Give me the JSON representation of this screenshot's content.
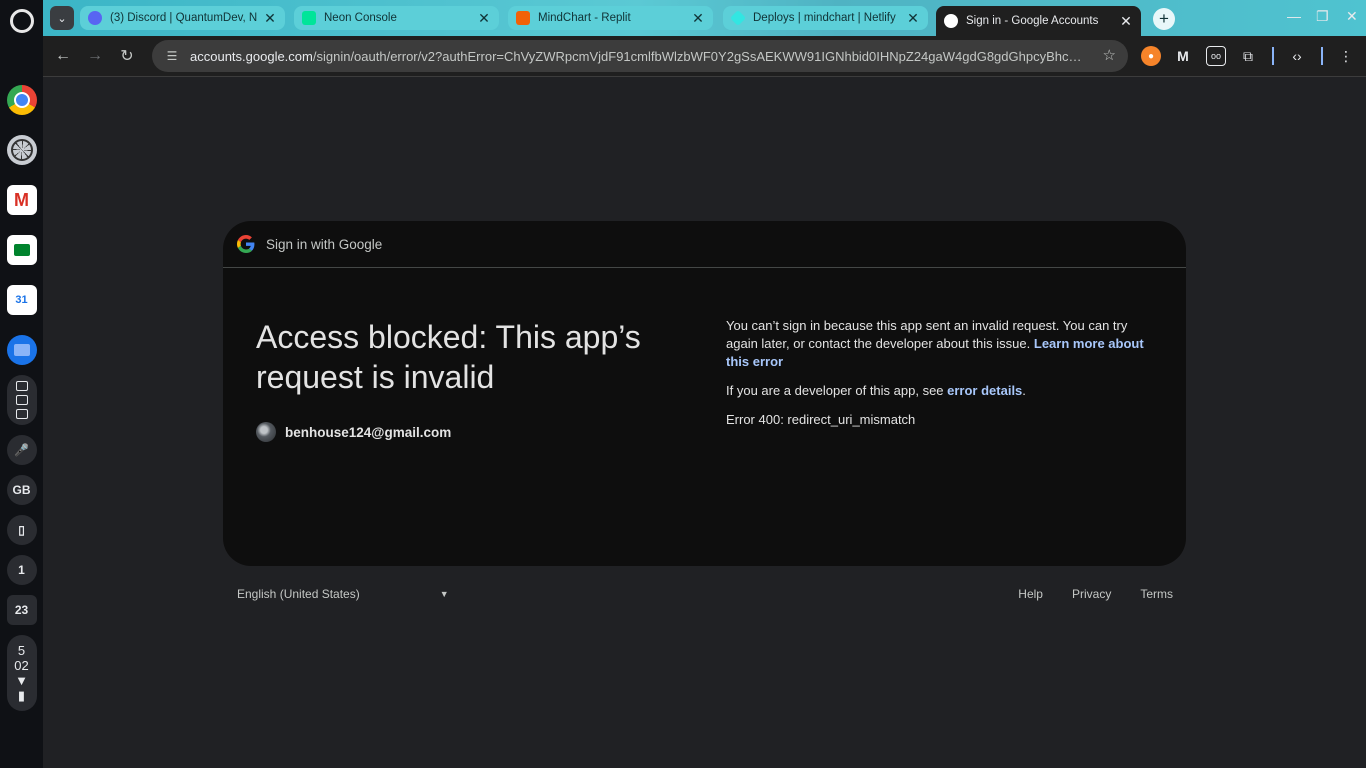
{
  "shelf": {
    "calendar_day": "31",
    "tray_gb": "GB",
    "tray_one": "1",
    "tray_date": "23",
    "clock_hour": "5",
    "clock_minute": "02"
  },
  "tabs": [
    {
      "title": "(3) Discord | QuantumDev, N",
      "favicon_color": "#5865f2"
    },
    {
      "title": "Neon Console",
      "favicon_color": "#00e599"
    },
    {
      "title": "MindChart - Replit",
      "favicon_color": "#f26207"
    },
    {
      "title": "Deploys | mindchart | Netlify",
      "favicon_color": "#32e6e2"
    },
    {
      "title": "Sign in - Google Accounts",
      "favicon_color": "#ffffff"
    }
  ],
  "omnibox": {
    "host": "accounts.google.com",
    "path": "/signin/oauth/error/v2?authError=ChVyZWRpcmVjdF91cmlfbWlzbWF0Y2gSsAEKWW91IGNhbid0IHNpZ24gaW4gdG8gdGhpcyBhcHAgY..."
  },
  "page": {
    "header_title": "Sign in with Google",
    "headline": "Access blocked: This app’s request is invalid",
    "email": "benhouse124@gmail.com",
    "msg1_text": "You can’t sign in because this app sent an invalid request. You can try again later, or contact the developer about this issue. ",
    "msg1_link": "Learn more about this error",
    "msg2_text": "If you are a developer of this app, see ",
    "msg2_link": "error details",
    "msg2_end": ".",
    "error_code": "Error 400: redirect_uri_mismatch"
  },
  "footer": {
    "language": "English (United States)",
    "help": "Help",
    "privacy": "Privacy",
    "terms": "Terms"
  },
  "colors": {
    "accent_link": "#a8c7fa",
    "page_bg": "#202124",
    "card_bg": "#0e0e0e"
  }
}
